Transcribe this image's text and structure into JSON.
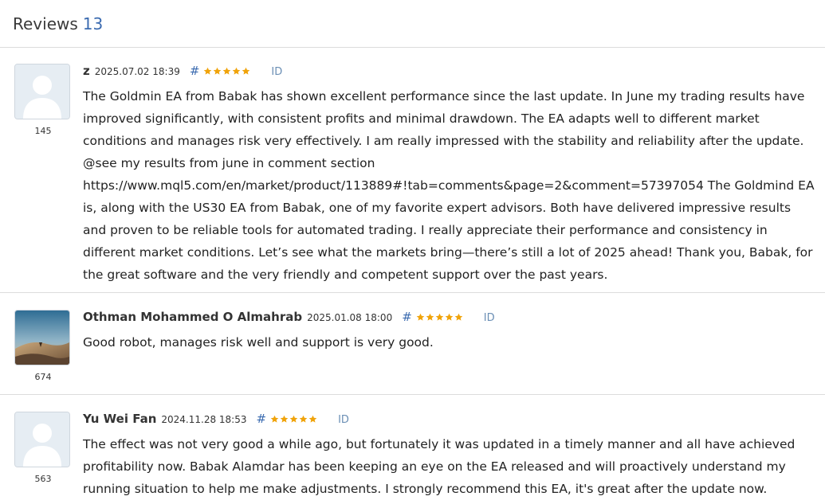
{
  "header": {
    "title": "Reviews",
    "count": "13"
  },
  "reviews": [
    {
      "author": "z",
      "date": "2025.07.02 18:39",
      "hash": "#",
      "stars": 5,
      "id_label": "ID",
      "rating_count": "145",
      "text": "The Goldmin EA from Babak has shown excellent performance since the last update. In June my trading results have improved significantly, with consistent profits and minimal drawdown. The EA adapts well to different market conditions and manages risk very effectively. I am really impressed with the stability and reliability after the update. @see my results from june in comment section https://www.mql5.com/en/market/product/113889#!tab=comments&page=2&comment=57397054 The Goldmind EA is, along with the US30 EA from Babak, one of my favorite expert advisors. Both have delivered impressive results and proven to be reliable tools for automated trading. I really appreciate their performance and consistency in different market conditions. Let’s see what the markets bring—there’s still a lot of 2025 ahead! Thank you, Babak, for the great software and the very friendly and competent support over the past years.",
      "avatar": "default-avatar-icon"
    },
    {
      "author": "Othman Mohammed O Almahrab",
      "date": "2025.01.08 18:00",
      "hash": "#",
      "stars": 5,
      "id_label": "ID",
      "rating_count": "674",
      "text": "Good robot, manages risk well and support is very good.",
      "avatar": "desert-photo-avatar"
    },
    {
      "author": "Yu Wei Fan",
      "date": "2024.11.28 18:53",
      "hash": "#",
      "stars": 5,
      "id_label": "ID",
      "rating_count": "563",
      "text": "The effect was not very good a while ago, but fortunately it was updated in a timely manner and all have achieved profitability now. Babak Alamdar has been keeping an eye on the EA released and will proactively understand my running situation to help me make adjustments. I strongly recommend this EA, it's great after the update now.",
      "avatar": "default-avatar-icon"
    }
  ],
  "colors": {
    "accent": "#3b6bb0",
    "star": "#f0a30a",
    "divider": "#dcdcdc"
  }
}
